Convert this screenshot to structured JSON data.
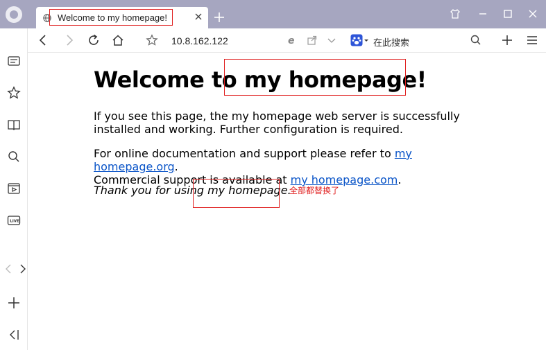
{
  "tab": {
    "title": "Welcome to my homepage!"
  },
  "nav": {
    "url": "10.8.162.122",
    "search_placeholder": "在此搜索"
  },
  "page": {
    "heading_prefix": "Welcome to ",
    "heading_highlight": "my homepage!",
    "p1": "If you see this page, the my homepage web server is successfully installed and working. Further configuration is required.",
    "p2_text1": "For online documentation and support please refer to ",
    "p2_link1": "my homepage.org",
    "p2_text2": ".",
    "p2_text3": "Commercial support is available at ",
    "p2_link2": "my homepage.com",
    "p2_text4": ".",
    "thanks_prefix": "Thank you for using ",
    "thanks_highlight": "my homepage",
    "thanks_suffix": ".",
    "annotation": "全部都替换了"
  },
  "colors": {
    "accent_red": "#e02020",
    "link": "#0b55c8",
    "titlebar": "#a6a6c0"
  }
}
